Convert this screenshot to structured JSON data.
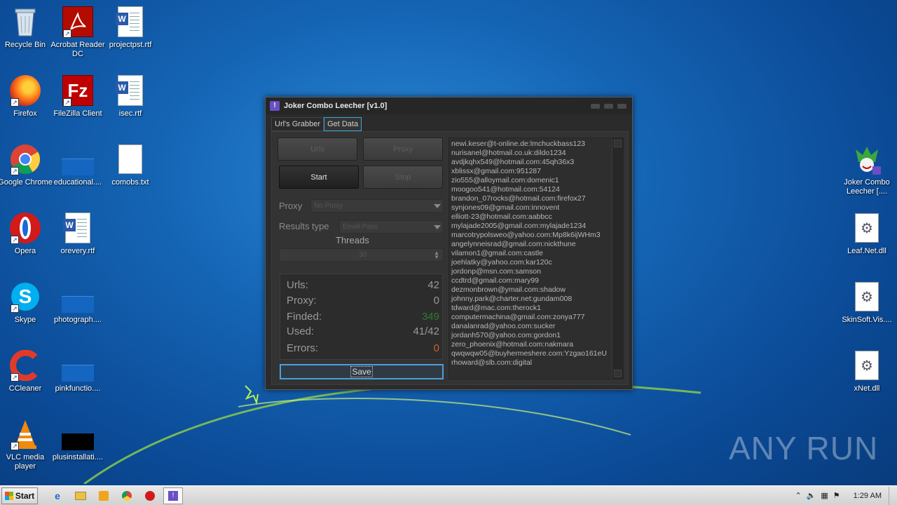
{
  "desktop": {
    "icons": [
      {
        "label": "Recycle Bin",
        "icon": "recycle-bin-icon"
      },
      {
        "label": "Acrobat Reader DC",
        "icon": "acrobat-icon"
      },
      {
        "label": "projectpst.rtf",
        "icon": "word-doc-icon"
      },
      {
        "label": "Firefox",
        "icon": "firefox-icon"
      },
      {
        "label": "FileZilla Client",
        "icon": "filezilla-icon"
      },
      {
        "label": "isec.rtf",
        "icon": "word-doc-icon"
      },
      {
        "label": "Google Chrome",
        "icon": "chrome-icon"
      },
      {
        "label": "educational....",
        "icon": "blank-file-icon"
      },
      {
        "label": "comobs.txt",
        "icon": "text-file-icon"
      },
      {
        "label": "Opera",
        "icon": "opera-icon"
      },
      {
        "label": "orevery.rtf",
        "icon": "word-doc-icon"
      },
      {
        "label": "Skype",
        "icon": "skype-icon"
      },
      {
        "label": "photograph....",
        "icon": "blank-file-icon"
      },
      {
        "label": "CCleaner",
        "icon": "ccleaner-icon"
      },
      {
        "label": "pinkfunctio....",
        "icon": "blank-file-icon"
      },
      {
        "label": "VLC media player",
        "icon": "vlc-icon"
      },
      {
        "label": "plusinstallati....",
        "icon": "blank-file-icon"
      },
      {
        "label": "Joker Combo Leecher [....",
        "icon": "joker-icon"
      },
      {
        "label": "Leaf.Net.dll",
        "icon": "dll-icon"
      },
      {
        "label": "SkinSoft.Vis....",
        "icon": "dll-icon"
      },
      {
        "label": "xNet.dll",
        "icon": "dll-icon"
      }
    ]
  },
  "window": {
    "title": "Joker Combo Leecher [v1.0]",
    "tabs": [
      {
        "label": "Url's Grabber",
        "active": false
      },
      {
        "label": "Get Data",
        "active": true
      }
    ],
    "buttons": {
      "links": "Urls",
      "proxy": "Proxy",
      "start": "Start",
      "stop": "Stop"
    },
    "proxy_label": "Proxy",
    "proxy_value": "No Proxy",
    "results_type_label": "Results type",
    "results_type_value": "Email:Pass",
    "threads_label": "Threads",
    "threads_value": "30",
    "stats": {
      "urls_label": "Urls:",
      "urls_value": "42",
      "proxy_label": "Proxy:",
      "proxy_value": "0",
      "finded_label": "Finded:",
      "finded_value": "349",
      "used_label": "Used:",
      "used_value": "41/42",
      "errors_label": "Errors:",
      "errors_value": "0"
    },
    "stat_colors": {
      "finded": "#2f7a2f",
      "errors": "#d0602a",
      "default": "#9a9a9a"
    },
    "save_label": "Save",
    "results": [
      "newi.keser@t-online.de:lmchuckbass123",
      "nurisanel@hotmail.co.uk:dildo1234",
      "avdjkqhx549@hotmail.com:45qh36x3",
      "xblissx@gmail.com:951287",
      "zio555@alloymail.com:domenic1",
      "moogoo541@hotmail.com:54124",
      "brandon_07rocks@hotmail.com:firefox27",
      "synjones09@gmail.com:innovent",
      "elliott-23@hotmail.com:aabbcc",
      "mylajade2005@gmail.com:mylajade1234",
      "marcotrypolsweo@yahoo.com:Mp8k6ijWHm3",
      "angelynneisrad@gmail.com:nickthune",
      "vilamon1@gmail.com:castle",
      "joehlatky@yahoo.com:kar120c",
      "jordonp@msn.com:samson",
      "ccdtrd@gmail.com:mary99",
      "dezmonbrown@ymail.com:shadow",
      "johnny.park@charter.net:gundam008",
      "tdward@mac.com:therock1",
      "computermachina@gmail.com:zonya777",
      "danalanrad@yahoo.com:sucker",
      "jordanh570@yahoo.com:gordon1",
      "zero_phoenix@hotmail.com:nakmara",
      "qwqwqw05@buyhermeshere.com:Yzgao161eU",
      "rhoward@slb.com:digital"
    ]
  },
  "watermark": "ANY RUN",
  "taskbar": {
    "start_label": "Start",
    "items": [
      "ie-icon",
      "explorer-icon",
      "media-player-icon",
      "chrome-icon",
      "opera-icon",
      "joker-icon"
    ],
    "clock": "1:29 AM"
  }
}
